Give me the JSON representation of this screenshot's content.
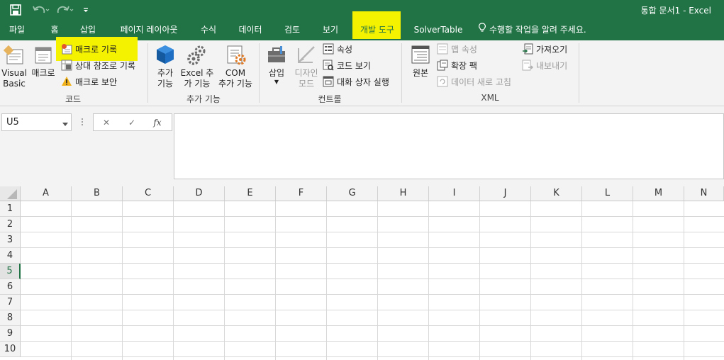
{
  "title": "통합 문서1 - Excel",
  "quick_access": {
    "save_icon": "save-icon",
    "undo_icon": "undo-icon",
    "redo_icon": "redo-icon",
    "customize_icon": "customize-toolbar-icon"
  },
  "tabs": [
    "파일",
    "홈",
    "삽입",
    "페이지 레이아웃",
    "수식",
    "데이터",
    "검토",
    "보기",
    "개발 도구",
    "SolverTable"
  ],
  "active_tab": "개발 도구",
  "tell_me": "수행할 작업을 알려 주세요.",
  "ribbon": {
    "code": {
      "label": "코드",
      "visual_basic": [
        "Visual",
        "Basic"
      ],
      "macro": "매크로",
      "record_macro": "매크로 기록",
      "relative_ref": "상대 참조로 기록",
      "macro_security": "매크로 보안"
    },
    "addins": {
      "label": "추가 기능",
      "addins": [
        "추가",
        "기능"
      ],
      "excel_addins": [
        "Excel 추",
        "가 기능"
      ],
      "com_addins": [
        "COM",
        "추가 기능"
      ]
    },
    "controls": {
      "label": "컨트롤",
      "insert": "삽입",
      "design_mode": [
        "디자인",
        "모드"
      ],
      "properties": "속성",
      "view_code": "코드 보기",
      "run_dialog": "대화 상자 실행"
    },
    "xml": {
      "label": "XML",
      "source": "원본",
      "map_properties": "맵 속성",
      "expansion_packs": "확장 팩",
      "refresh_data": "데이터 새로 고침",
      "import": "가져오기",
      "export": "내보내기"
    }
  },
  "formula_bar": {
    "name_box": "U5",
    "cancel_icon": "✕",
    "enter_icon": "✓",
    "fx_label": "fx",
    "value": ""
  },
  "columns": [
    "A",
    "B",
    "C",
    "D",
    "E",
    "F",
    "G",
    "H",
    "I",
    "J",
    "K",
    "L",
    "M",
    "N"
  ],
  "rows": [
    "1",
    "2",
    "3",
    "4",
    "5",
    "6",
    "7",
    "8",
    "9",
    "10"
  ],
  "selected_row": "5",
  "colors": {
    "excel_green": "#217346",
    "highlight": "#f5f200"
  }
}
